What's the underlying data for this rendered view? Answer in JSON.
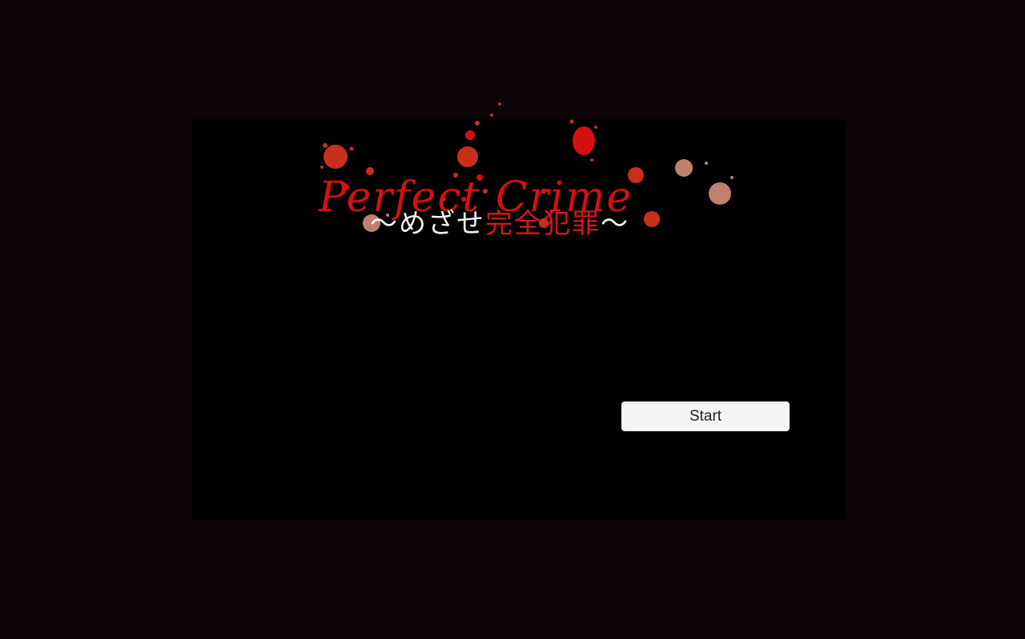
{
  "colors": {
    "page_background": "#0d0206",
    "game_background": "#000000",
    "title_red": "#d41010",
    "splatter_red": "#c8301c",
    "splatter_faded": "#c08070",
    "subtitle_white": "#f2f2f2",
    "button_background": "#f4f4f4"
  },
  "title": {
    "main": "Perfect Crime",
    "subtitle_wave_left": "〜",
    "subtitle_kana": "めざせ",
    "subtitle_kanji": "完全犯罪",
    "subtitle_wave_right": "〜"
  },
  "menu": {
    "start_label": "Start"
  },
  "decorations": {
    "logo_style": "blood-splatter"
  }
}
